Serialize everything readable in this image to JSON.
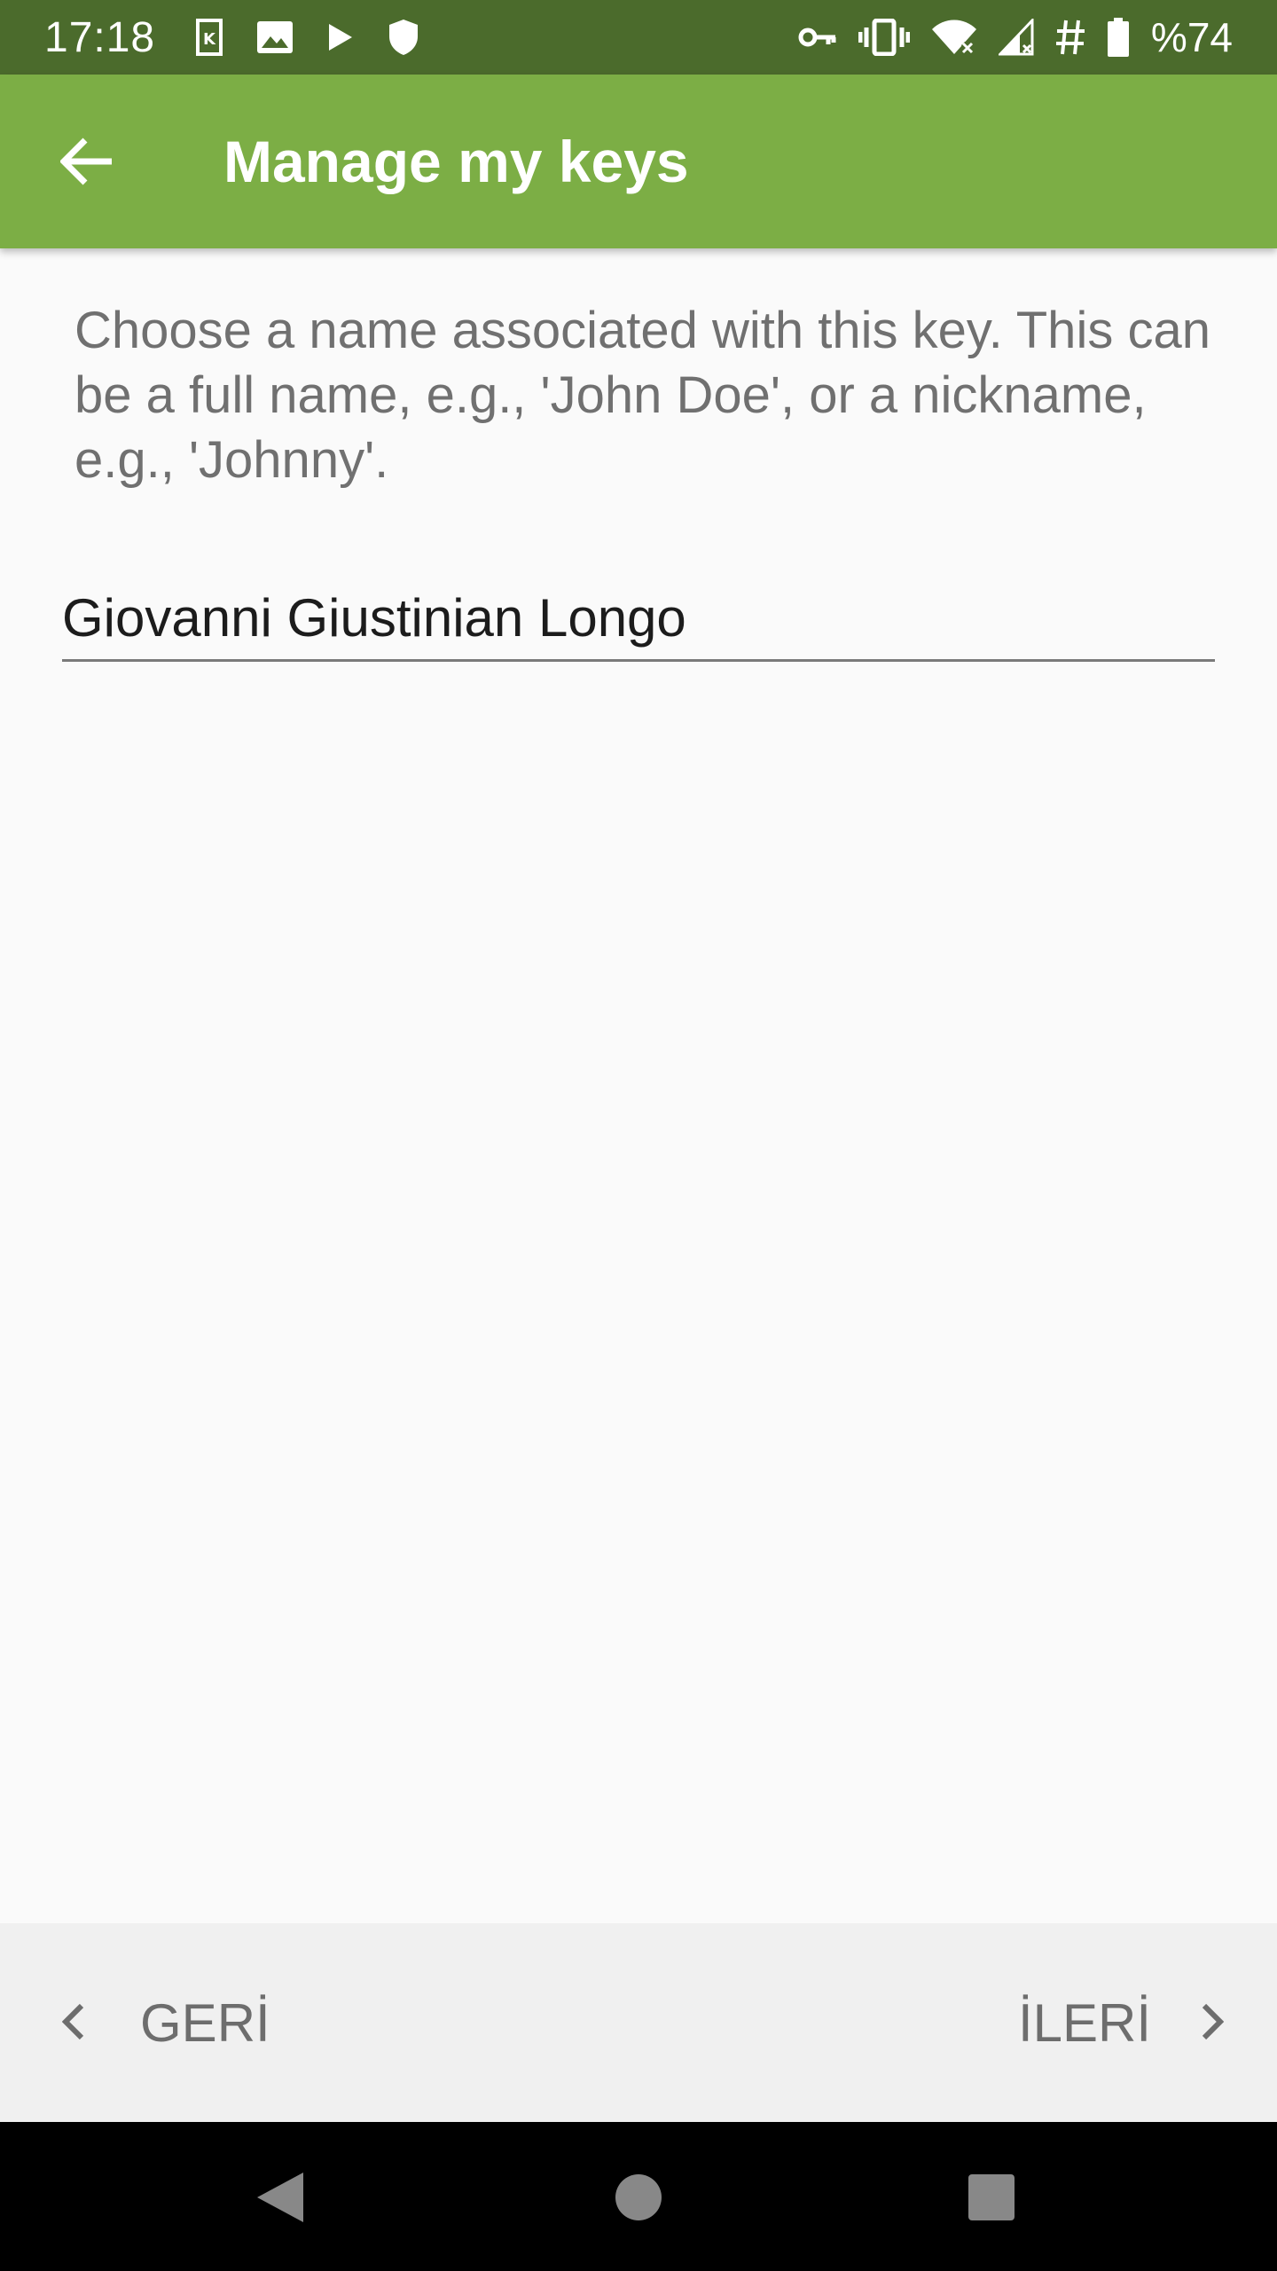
{
  "status_bar": {
    "time": "17:18",
    "battery": "%74",
    "icons_left": [
      "keepass-icon",
      "image-icon",
      "play-icon",
      "shield-icon"
    ],
    "icons_right": [
      "vpn-key-icon",
      "vibrate-icon",
      "wifi-icon",
      "signal-icon",
      "hash-icon",
      "battery-icon"
    ]
  },
  "app_bar": {
    "title": "Manage my keys",
    "background": "#7cae45"
  },
  "content": {
    "description": "Choose a name associated with this key. This can be a full name, e.g., 'John Doe', or a nickname, e.g., 'Johnny'.",
    "name_value": "Giovanni Giustinian Longo"
  },
  "wizard": {
    "back_label": "GERİ",
    "next_label": "İLERİ"
  },
  "colors": {
    "status_bar": "#4b6b2c",
    "accent": "#7cae45",
    "text_secondary": "#707070"
  }
}
